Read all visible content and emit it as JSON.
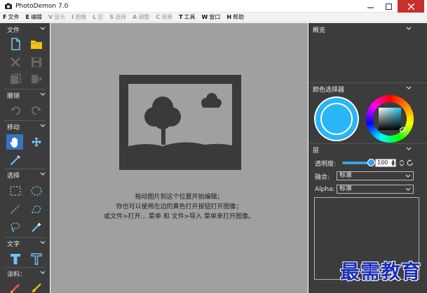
{
  "window": {
    "title": "PhotoDemon 7.0"
  },
  "menu": [
    {
      "key": "F",
      "label": "文件",
      "enabled": true
    },
    {
      "key": "E",
      "label": "编辑",
      "enabled": true
    },
    {
      "key": "V",
      "label": "显示",
      "enabled": false
    },
    {
      "key": "I",
      "label": "图像",
      "enabled": false
    },
    {
      "key": "L",
      "label": "层",
      "enabled": false
    },
    {
      "key": "S",
      "label": "选择",
      "enabled": false
    },
    {
      "key": "A",
      "label": "调整",
      "enabled": false
    },
    {
      "key": "C",
      "label": "效果",
      "enabled": false
    },
    {
      "key": "T",
      "label": "工具",
      "enabled": true
    },
    {
      "key": "W",
      "label": "窗口",
      "enabled": true
    },
    {
      "key": "H",
      "label": "帮助",
      "enabled": true
    }
  ],
  "left_toolbar": {
    "sections": {
      "file": "文件",
      "undo": "撤销",
      "move": "移动",
      "select": "选择",
      "text": "文字",
      "paint": "涂料："
    },
    "active_tool": "hand-tool"
  },
  "canvas": {
    "hint_lines": [
      "拖动图片到这个位置开始编辑；",
      "你也可以使用左边的黄色打开按钮打开图像；",
      "或文件>打开... 菜单 和 文件>导入 菜单来打开图像。"
    ]
  },
  "right_panel": {
    "overview_title": "概览",
    "color_selector_title": "颜色选择器",
    "layers_title": "层",
    "opacity_label": "透明度:",
    "opacity_value": "100",
    "opacity_level": 1.0,
    "blend_label": "融合:",
    "blend_value": "标准",
    "alpha_label": "Alpha:",
    "alpha_value": "标准"
  },
  "colors": {
    "toolbar_bg": "#3c3c3c",
    "canvas_bg": "#a0a0a0",
    "accent_blue": "#3574c4",
    "primary_color": "#29b6f6",
    "open_folder_yellow": "#f2c21d",
    "close_button": "#c9302c"
  },
  "watermark": {
    "text": "最需教育"
  }
}
